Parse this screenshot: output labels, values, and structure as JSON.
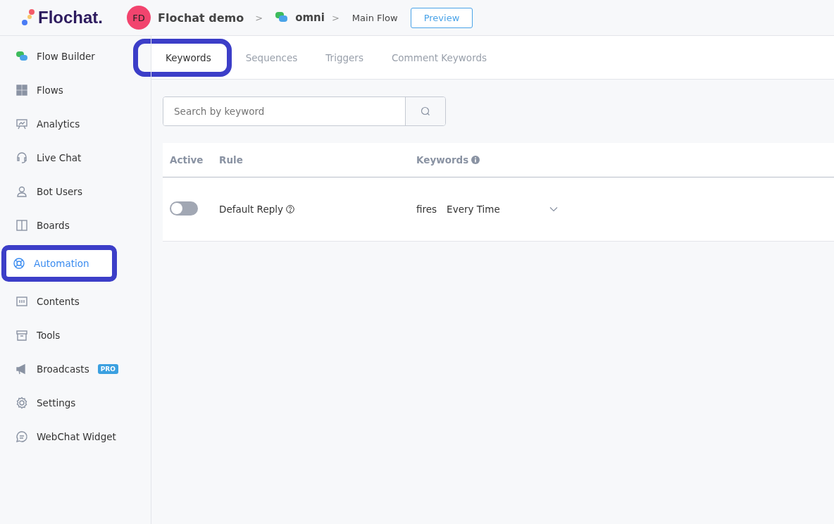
{
  "header": {
    "logo": "Flochat.",
    "avatar": "FD",
    "workspace": "Flochat demo",
    "separator_1": ">",
    "channel": "omni",
    "separator_2": ">",
    "flow": "Main Flow",
    "preview_button": "Preview"
  },
  "sidebar": {
    "items": [
      {
        "label": "Flow Builder",
        "selected": false,
        "highlighted": false
      },
      {
        "label": "Flows",
        "selected": false,
        "highlighted": false
      },
      {
        "label": "Analytics",
        "selected": false,
        "highlighted": false
      },
      {
        "label": "Live Chat",
        "selected": false,
        "highlighted": false
      },
      {
        "label": "Bot Users",
        "selected": false,
        "highlighted": false
      },
      {
        "label": "Boards",
        "selected": false,
        "highlighted": false
      },
      {
        "label": "Automation",
        "selected": true,
        "highlighted": true
      },
      {
        "label": "Contents",
        "selected": false,
        "highlighted": false
      },
      {
        "label": "Tools",
        "selected": false,
        "highlighted": false
      },
      {
        "label": "Broadcasts",
        "selected": false,
        "highlighted": false,
        "badge": "PRO"
      },
      {
        "label": "Settings",
        "selected": false,
        "highlighted": false
      },
      {
        "label": "WebChat Widget",
        "selected": false,
        "highlighted": false
      }
    ]
  },
  "tabs": [
    {
      "label": "Keywords",
      "selected": true,
      "highlighted": true
    },
    {
      "label": "Sequences",
      "selected": false,
      "highlighted": false
    },
    {
      "label": "Triggers",
      "selected": false,
      "highlighted": false
    },
    {
      "label": "Comment Keywords",
      "selected": false,
      "highlighted": false
    }
  ],
  "search": {
    "placeholder": "Search by keyword"
  },
  "table": {
    "columns": [
      "Active",
      "Rule",
      "Keywords"
    ],
    "rows": [
      {
        "active": false,
        "rule": "Default Reply",
        "keyword_prefix": "fires",
        "keyword_mode": "Every Time"
      }
    ]
  }
}
